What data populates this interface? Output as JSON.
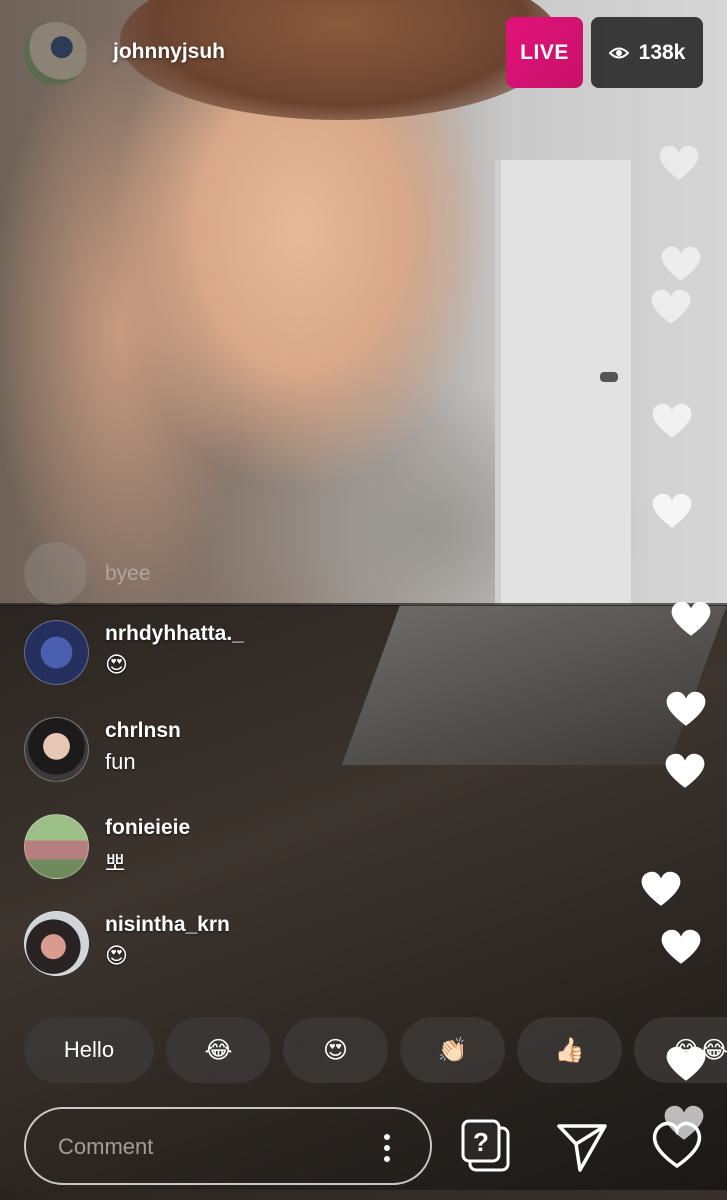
{
  "header": {
    "username": "johnnyjsuh",
    "live_label": "LIVE",
    "viewer_count": "138k"
  },
  "faded_comment": {
    "text": "byee"
  },
  "comments": [
    {
      "username": "nrhdyhhatta._",
      "text": "😍"
    },
    {
      "username": "chrlnsn",
      "text": "fun"
    },
    {
      "username": "fonieieie",
      "text": "뽀"
    },
    {
      "username": "nisintha_krn",
      "text": "😍"
    }
  ],
  "quick_replies": [
    "Hello",
    "😂",
    "😍",
    "👏🏻",
    "👍🏻",
    "😂😂"
  ],
  "composer": {
    "placeholder": "Comment"
  },
  "icons": {
    "viewers": "eye-icon",
    "more": "more-vertical-icon",
    "question": "question-sticker-icon",
    "send": "send-icon",
    "like": "heart-icon"
  },
  "colors": {
    "live_badge": "#D91474",
    "viewer_badge": "#282828"
  }
}
